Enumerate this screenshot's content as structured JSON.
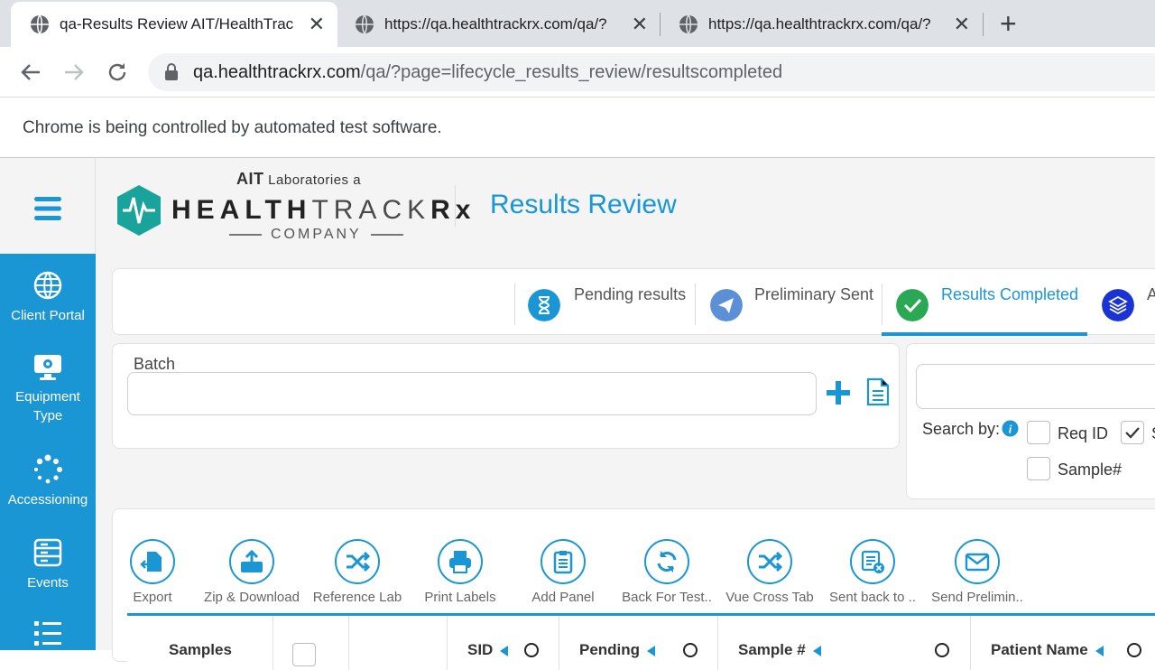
{
  "browser": {
    "tabs": [
      {
        "title": "qa-Results Review AIT/HealthTrac"
      },
      {
        "title": "https://qa.healthtrackrx.com/qa/?"
      },
      {
        "title": "https://qa.healthtrackrx.com/qa/?"
      }
    ],
    "url_host": "qa.healthtrackrx.com",
    "url_path": "/qa/?page=lifecycle_results_review/resultscompleted",
    "infobar": "Chrome is being controlled by automated test software."
  },
  "sidebar": {
    "items": [
      {
        "label": "Client Portal",
        "icon": "globe-icon"
      },
      {
        "label": "Equipment Type",
        "icon": "monitor-gear-icon"
      },
      {
        "label": "Accessioning",
        "icon": "spinner-icon"
      },
      {
        "label": "Events",
        "icon": "server-icon"
      },
      {
        "label": "",
        "icon": "list-icon"
      }
    ]
  },
  "header": {
    "logo_ait": "AIT",
    "logo_lab": " Laboratories a",
    "logo_health": "HEALTH",
    "logo_track": "TRACK",
    "logo_rx": "Rx",
    "logo_company": "COMPANY",
    "page_title": "Results Review"
  },
  "status_tabs": [
    {
      "label": "Pending results",
      "icon": "hourglass-icon",
      "color": "#1b96d5"
    },
    {
      "label": "Preliminary Sent",
      "icon": "paper-plane-icon",
      "color": "#5b8fd6"
    },
    {
      "label": "Results Completed",
      "icon": "check-icon",
      "color": "#2aa853",
      "active": true
    },
    {
      "label": "A",
      "icon": "layers-icon",
      "color": "#1a34d4"
    }
  ],
  "batch": {
    "label": "Batch",
    "value": ""
  },
  "search": {
    "value": "",
    "search_by_label": "Search by:",
    "options": [
      {
        "label": "Req ID",
        "checked": false
      },
      {
        "label": "S",
        "checked": true
      },
      {
        "label": "Sample#",
        "checked": false
      }
    ]
  },
  "actions": [
    {
      "label": "Export",
      "icon": "export-icon"
    },
    {
      "label": "Zip & Download",
      "icon": "upload-icon"
    },
    {
      "label": "Reference Lab",
      "icon": "shuffle-icon"
    },
    {
      "label": "Print Labels",
      "icon": "print-icon"
    },
    {
      "label": "Add Panel",
      "icon": "clipboard-icon"
    },
    {
      "label": "Back For Test..",
      "icon": "refresh-icon"
    },
    {
      "label": "Vue Cross Tab",
      "icon": "shuffle-icon"
    },
    {
      "label": "Sent back to ..",
      "icon": "document-x-icon"
    },
    {
      "label": "Send Prelimin..",
      "icon": "envelope-icon"
    }
  ],
  "grid": {
    "columns": [
      "Samples",
      "",
      "",
      "SID",
      "Pending",
      "Sample #",
      "Patient Name"
    ]
  },
  "colors": {
    "accent": "#1b96d5",
    "sidebar": "#1b96d5"
  }
}
